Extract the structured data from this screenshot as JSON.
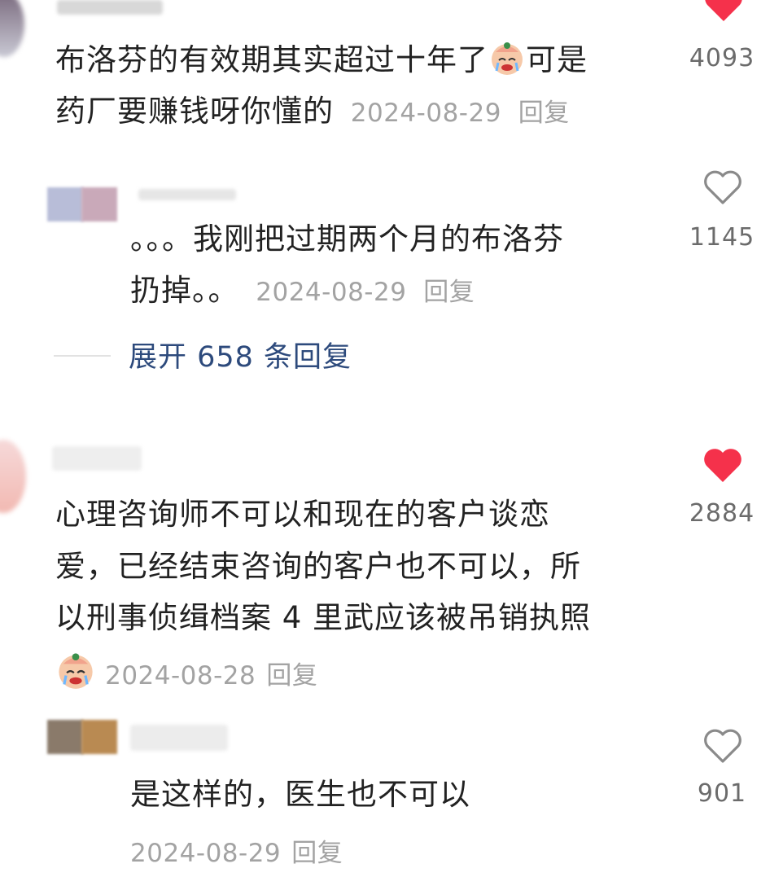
{
  "comments": [
    {
      "text_line1": "布洛芬的有效期其实超过十年了",
      "text_line1b": "可是",
      "text_line2": "药厂要赚钱呀你懂的",
      "date": "2024-08-29",
      "reply_label": "回复",
      "likes": "4093",
      "liked": true
    },
    {
      "text_line1": "。。。我刚把过期两个月的布洛芬",
      "text_line2": "扔掉。。",
      "date": "2024-08-29",
      "reply_label": "回复",
      "likes": "1145",
      "liked": false
    },
    {
      "expand_label": "展开 658 条回复"
    },
    {
      "text_line1": "心理咨询师不可以和现在的客户谈恋",
      "text_line2": "爱，已经结束咨询的客户也不可以，所",
      "text_line3": "以刑事侦缉档案 4 里武应该被吊销执照",
      "date": "2024-08-28",
      "reply_label": "回复",
      "likes": "2884",
      "liked": true
    },
    {
      "text_line1": "是这样的，医生也不可以",
      "date": "2024-08-29",
      "reply_label": "回复",
      "likes": "901",
      "liked": false
    }
  ],
  "colors": {
    "heart_liked": "#f5314b",
    "heart_outline": "#8a8a8a",
    "expand_link": "#2d4a7c"
  },
  "icons": {
    "liked": "heart-filled-icon",
    "unliked": "heart-outline-icon",
    "emoji": "crying-face-emoji-icon"
  }
}
